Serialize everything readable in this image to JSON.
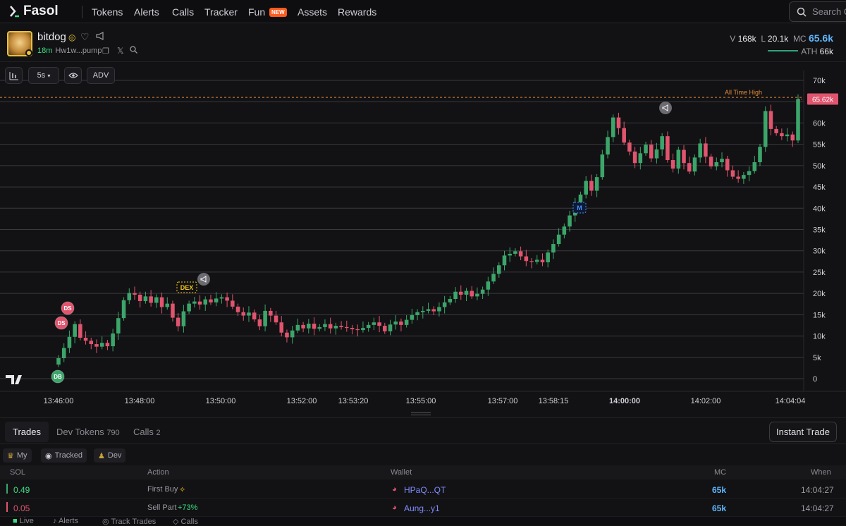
{
  "nav": {
    "logo": "Fasol",
    "items": [
      "Tokens",
      "Alerts",
      "Calls",
      "Tracker",
      "Fun",
      "Assets",
      "Rewards"
    ],
    "new_badge": "NEW",
    "search_placeholder": "Search C"
  },
  "token": {
    "name": "bitdog",
    "age": "18m",
    "address": "Hw1w...pump",
    "volume_label": "V",
    "volume": "168k",
    "liquidity_label": "L",
    "liquidity": "20.1k",
    "mc_label": "MC",
    "mc": "65.6k",
    "ath_label": "ATH",
    "ath": "66k"
  },
  "toolbar": {
    "interval": "5s",
    "adv": "ADV"
  },
  "chart_data": {
    "type": "candlestick",
    "y_ticks": [
      "70k",
      "65k",
      "60k",
      "55k",
      "50k",
      "45k",
      "40k",
      "35k",
      "30k",
      "25k",
      "20k",
      "15k",
      "10k",
      "5k",
      "0"
    ],
    "ylim": [
      0,
      70000
    ],
    "x_ticks": [
      "13:46:00",
      "13:48:00",
      "13:50:00",
      "13:52:00",
      "13:53:20",
      "13:55:00",
      "13:57:00",
      "13:58:15",
      "14:00:00",
      "14:02:00",
      "14:04:04"
    ],
    "ath_label": "All Time High",
    "ath_value": 66000,
    "current_price_label": "65.62k",
    "current_price": 65620,
    "markers": {
      "db": "DB",
      "ds": "DS",
      "dex": "DEX",
      "m": "M"
    },
    "colors": {
      "up": "#3ca56a",
      "down": "#e0546e",
      "ath_line": "#e38a3a",
      "marker_ds": "#e0546e",
      "marker_db": "#3ca56a",
      "marker_dex": "#f5c518",
      "marker_m": "#4d8dff"
    },
    "candles_close": [
      4800,
      7200,
      9800,
      12800,
      9600,
      8900,
      8100,
      7500,
      8400,
      7600,
      10600,
      14200,
      18400,
      20100,
      19700,
      18200,
      19300,
      17800,
      19100,
      16800,
      17600,
      14300,
      12300,
      15800,
      17600,
      18100,
      17400,
      18600,
      17900,
      18800,
      19100,
      18300,
      16900,
      15600,
      14800,
      15500,
      13900,
      12300,
      15900,
      14800,
      13200,
      10800,
      9700,
      11300,
      12600,
      11800,
      12900,
      11700,
      12100,
      12800,
      11800,
      12400,
      12100,
      11900,
      11600,
      11400,
      11900,
      12600,
      13200,
      12400,
      11100,
      12700,
      13400,
      12600,
      13800,
      14900,
      15600,
      15900,
      16300,
      15800,
      16800,
      17900,
      18700,
      20400,
      19700,
      20600,
      19300,
      19900,
      20900,
      22800,
      24600,
      26600,
      28900,
      29300,
      29900,
      28700,
      27600,
      27400,
      27900,
      27300,
      29600,
      31600,
      33800,
      35700,
      38300,
      40900,
      43200,
      46400,
      44100,
      47300,
      52600,
      56700,
      61300,
      58800,
      55400,
      53300,
      50600,
      52900,
      54900,
      51700,
      53800,
      56900,
      51300,
      49300,
      53700,
      50600,
      48600,
      51900,
      55200,
      52100,
      49800,
      50800,
      51600,
      48900,
      47400,
      46900,
      47800,
      48700,
      50800,
      54400,
      62800,
      58600,
      57600,
      56900,
      57300,
      55900,
      65620
    ]
  },
  "tabs": {
    "trades": "Trades",
    "dev_tokens": "Dev Tokens",
    "dev_tokens_count": "790",
    "calls": "Calls",
    "calls_count": "2",
    "instant_trade": "Instant Trade"
  },
  "filters": [
    "My",
    "Tracked",
    "Dev"
  ],
  "table": {
    "headers": [
      "SOL",
      "Action",
      "Wallet",
      "MC",
      "When"
    ],
    "rows": [
      {
        "sol": "0.49",
        "action": "First Buy",
        "action_extra": "",
        "wallet": "HPaQ...QT",
        "mc": "65k",
        "when": "14:04:27",
        "side": "buy"
      },
      {
        "sol": "0.05",
        "action": "Sell Part",
        "action_extra": "+73%",
        "wallet": "Aung...y1",
        "mc": "65k",
        "when": "14:04:27",
        "side": "sell"
      }
    ]
  },
  "bottom": [
    "Live",
    "Alerts",
    "Track Trades",
    "Calls"
  ]
}
